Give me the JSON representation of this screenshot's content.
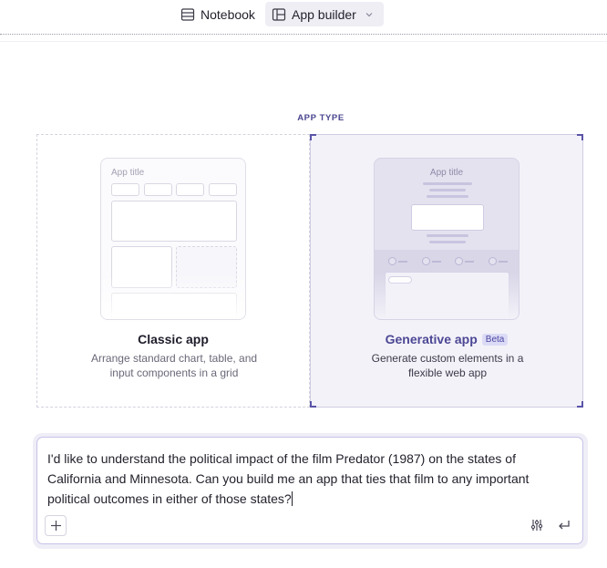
{
  "topbar": {
    "tabs": [
      {
        "label": "Notebook",
        "icon": "notebook-icon",
        "active": false
      },
      {
        "label": "App builder",
        "icon": "app-builder-icon",
        "active": true,
        "dropdown": true
      }
    ]
  },
  "app_type": {
    "label": "APP TYPE",
    "options": [
      {
        "title": "Classic app",
        "description": "Arrange standard chart, table, and input components in a grid",
        "preview_title": "App title",
        "selected": false
      },
      {
        "title": "Generative app",
        "badge": "Beta",
        "description": "Generate custom elements in a flexible web app",
        "preview_title": "App title",
        "selected": true
      }
    ]
  },
  "prompt": {
    "value": "I'd like to understand the political impact of the film Predator (1987) on the states of California and Minnesota. Can you build me an app that ties that film to any important political outcomes in either of those states?",
    "actions": [
      "add-icon",
      "settings-sliders-icon",
      "enter-icon"
    ]
  },
  "colors": {
    "accent": "#4c4795",
    "selected_card_bg": "#f3f2f8",
    "prompt_border": "#c6c2e8"
  }
}
